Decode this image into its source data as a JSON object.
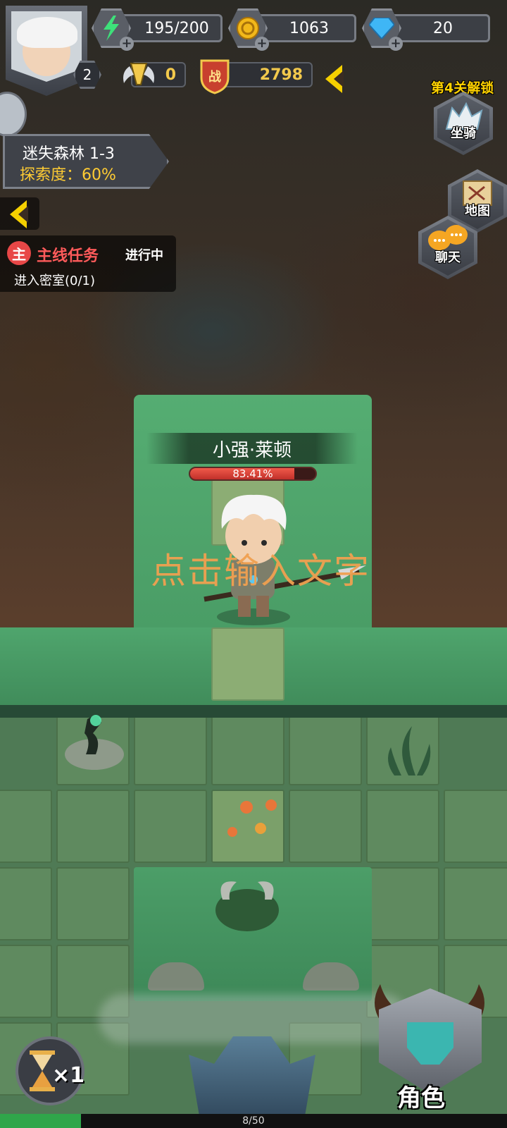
{
  "player": {
    "level": "2"
  },
  "resources": {
    "energy": "195/200",
    "gold": "1063",
    "diamond": "20",
    "vip": "0",
    "power": "2798"
  },
  "stage": {
    "name": "迷失森林 1-3",
    "progress": "探索度：60%"
  },
  "quest": {
    "badge": "主",
    "title": "主线任务",
    "status": "进行中",
    "desc": "进入密室(0/1)"
  },
  "side_buttons": {
    "unlock_hint": "第4关解锁",
    "mount": "坐骑",
    "map": "地图",
    "chat": "聊天"
  },
  "character": {
    "name": "小强·莱顿",
    "hp_text": "83.41%",
    "hp_fraction": 0.8341
  },
  "overlay_text": "点击输入文字",
  "speed": {
    "label": "×1"
  },
  "role_button": {
    "label": "角色"
  },
  "bottom_progress": {
    "text": "8/50",
    "fraction": 0.16
  },
  "colors": {
    "gold_text": "#ffcc33",
    "quest_red": "#e84747",
    "grass": "#4a9e68",
    "hp_red": "#e04a3a",
    "accent_yellow": "#f5d000"
  },
  "icons": [
    "avatar",
    "energy-bolt-icon",
    "gold-coin-icon",
    "diamond-icon",
    "vip-wings-icon",
    "power-shield-icon",
    "collapse-chevron-icon",
    "mount-wolf-icon",
    "map-scroll-icon",
    "chat-bubble-icon",
    "hourglass-icon",
    "helmet-icon"
  ]
}
